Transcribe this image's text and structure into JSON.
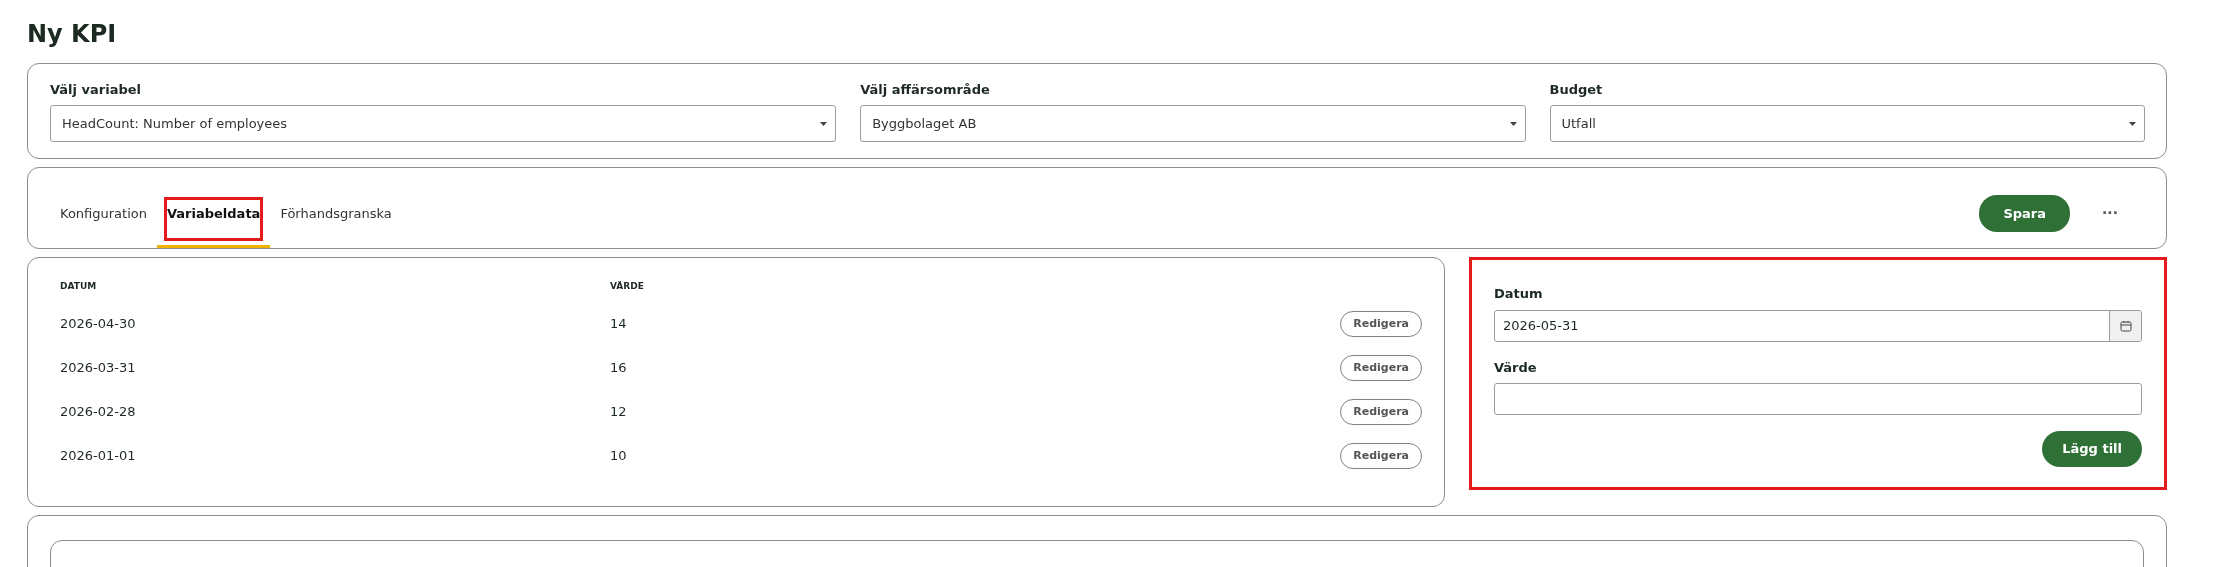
{
  "page_title": "Ny KPI",
  "selectors": [
    {
      "label": "Välj variabel",
      "value": "HeadCount: Number of employees"
    },
    {
      "label": "Välj affärsområde",
      "value": "Byggbolaget AB"
    },
    {
      "label": "Budget",
      "value": "Utfall"
    }
  ],
  "tabs": [
    {
      "label": "Konfiguration",
      "selected": false,
      "highlighted": false
    },
    {
      "label": "Variabeldata",
      "selected": true,
      "highlighted": true
    },
    {
      "label": "Förhandsgranska",
      "selected": false,
      "highlighted": false
    }
  ],
  "save_button": "Spara",
  "more_button": "···",
  "table": {
    "columns": [
      "DATUM",
      "VÄRDE"
    ],
    "rows": [
      {
        "date": "2026-04-30",
        "value": "14",
        "action": "Redigera"
      },
      {
        "date": "2026-03-31",
        "value": "16",
        "action": "Redigera"
      },
      {
        "date": "2026-02-28",
        "value": "12",
        "action": "Redigera"
      },
      {
        "date": "2026-01-01",
        "value": "10",
        "action": "Redigera"
      }
    ]
  },
  "form": {
    "highlighted": true,
    "date_label": "Datum",
    "date_value": "2026-05-31",
    "value_label": "Värde",
    "submit": "Lägg till"
  }
}
